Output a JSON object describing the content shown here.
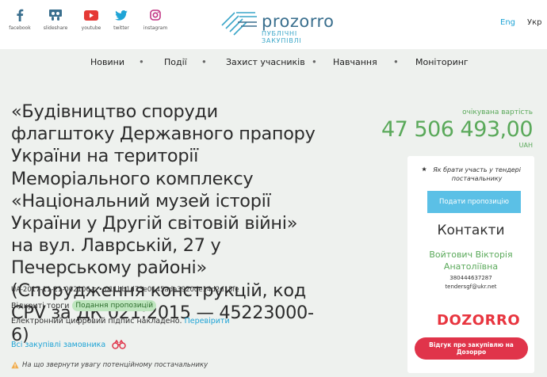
{
  "social": [
    {
      "label": "facebook",
      "icon": "facebook-icon"
    },
    {
      "label": "slideshare",
      "icon": "slideshare-icon"
    },
    {
      "label": "youtube",
      "icon": "youtube-icon"
    },
    {
      "label": "twitter",
      "icon": "twitter-icon"
    },
    {
      "label": "instagram",
      "icon": "instagram-icon"
    }
  ],
  "logo": {
    "wordmark": "prozorro",
    "tagline": "ПУБЛІЧНІ ЗАКУПІВЛІ"
  },
  "lang": {
    "en": "Eng",
    "uk": "Укр"
  },
  "nav": [
    "Новини",
    "Події",
    "Захист учасників",
    "Навчання",
    "Моніторинг"
  ],
  "tender": {
    "title": "«Будівництво споруди флагштоку Державного прапору України на території Меморіального комплексу «Національний музей історії України у Другій світовій війні» на вул. Лаврській, 27 у Печерському районі» (Спорудження конструкцій, код CPV за ДК 021:2015 — 45223000-6)",
    "id": "UA-2017-11-21-002106-c • 011bb1d73e0145ada3920de14d2d18fe",
    "procedure": "Відкриті торги",
    "status": "Подання пропозицій",
    "signature_text": "Електронний цифровий підпис накладено.",
    "signature_link": "Перевірити",
    "buyer_link": "Всі закупівлі замовника",
    "attention": "На що звернути увагу потенційному постачальнику"
  },
  "price": {
    "label": "очікувана вартість",
    "value": "47 506 493,00",
    "currency": "UAH"
  },
  "panel": {
    "how_to": "Як брати участь у тендері постачальнику",
    "submit": "Подати пропозицію",
    "contacts_title": "Контакти",
    "contact_name": "Войтович Вікторія Анатоліївна",
    "phone": "380444637287",
    "email": "tendersgf@ukr.net",
    "dozorro_logo": "DOZORRO",
    "dozorro_btn": "Відгук про закупівлю на Дозорро"
  },
  "colors": {
    "accent": "#1fa4d6",
    "green": "#5aa95a",
    "dozorro": "#e0344a",
    "bg": "#eef1ee"
  }
}
